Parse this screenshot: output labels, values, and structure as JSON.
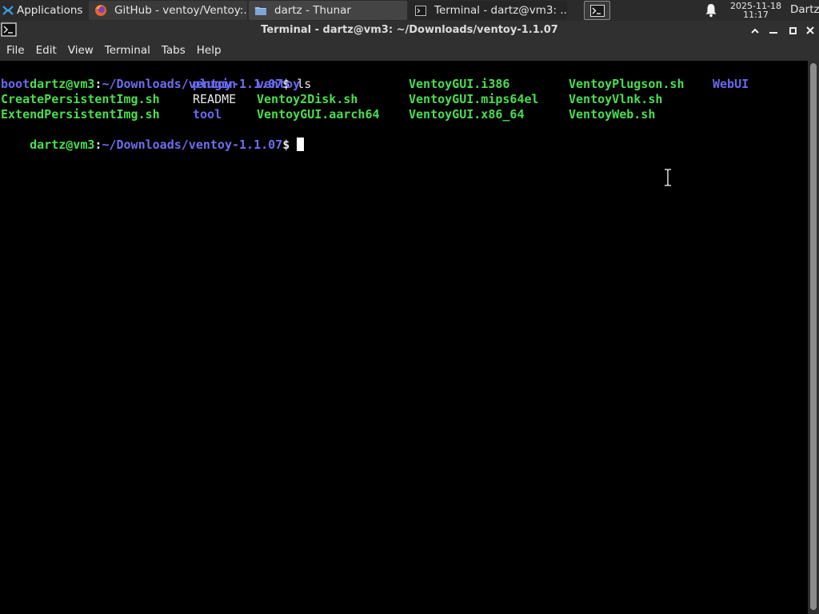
{
  "panel": {
    "apps_label": "Applications",
    "tasks": [
      {
        "label": "GitHub - ventoy/Ventoy:...",
        "icon": "firefox-icon"
      },
      {
        "label": "dartz - Thunar",
        "icon": "folder-icon"
      },
      {
        "label": "Terminal - dartz@vm3: ...",
        "icon": "terminal-icon"
      }
    ],
    "clock_date": "2025-11-18",
    "clock_time": "11:17",
    "user": "Dartz"
  },
  "window": {
    "title": "Terminal - dartz@vm3: ~/Downloads/ventoy-1.1.07"
  },
  "menubar": {
    "items": [
      "File",
      "Edit",
      "View",
      "Terminal",
      "Tabs",
      "Help"
    ]
  },
  "terminal": {
    "prompt_user": "dartz@vm3",
    "prompt_sep": ":",
    "prompt_path": "~/Downloads/ventoy-1.1.07",
    "prompt_end": "$ ",
    "command": "ls",
    "listing": {
      "col1": [
        "boot",
        "CreatePersistentImg.sh",
        "ExtendPersistentImg.sh"
      ],
      "col2": [
        "plugin",
        "README",
        "tool"
      ],
      "col3": [
        "ventoy",
        "Ventoy2Disk.sh",
        "VentoyGUI.aarch64"
      ],
      "col4": [
        "VentoyGUI.i386",
        "VentoyGUI.mips64el",
        "VentoyGUI.x86_64"
      ],
      "col5": [
        "VentoyPlugson.sh",
        "VentoyVlnk.sh",
        "VentoyWeb.sh"
      ],
      "col6": [
        "WebUI"
      ]
    }
  },
  "colors": {
    "prompt_green": "#4ade4f",
    "path_blue": "#6d6df0",
    "directory_blue": "#6868f0",
    "executable_green": "#4ade4f"
  }
}
